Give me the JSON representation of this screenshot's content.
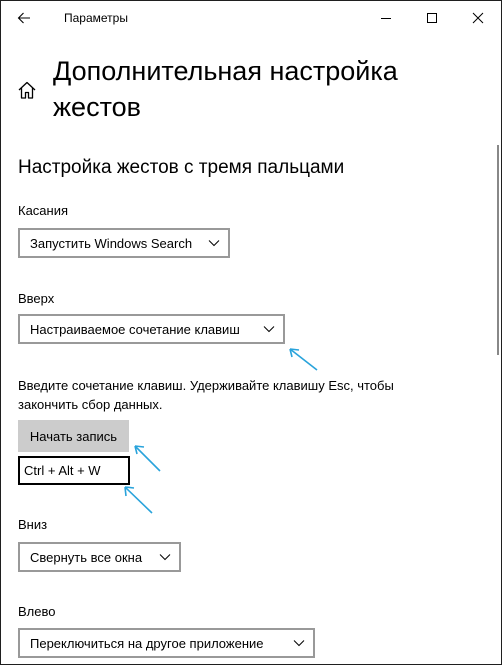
{
  "window": {
    "title": "Параметры",
    "icons": {
      "back": "back-arrow-icon",
      "minimize": "minimize-icon",
      "maximize": "maximize-icon",
      "close": "close-icon",
      "home": "home-icon"
    }
  },
  "page": {
    "title": "Дополнительная настройка жестов",
    "section_title": "Настройка жестов с тремя пальцами"
  },
  "taps": {
    "label": "Касания",
    "value": "Запустить Windows Search"
  },
  "up": {
    "label": "Вверх",
    "value": "Настраиваемое сочетание клавиш"
  },
  "shortcut": {
    "hint": "Введите сочетание клавиш. Удерживайте клавишу Esc, чтобы закончить сбор данных.",
    "record_label": "Начать запись",
    "value": "Ctrl + Alt + W"
  },
  "down": {
    "label": "Вниз",
    "value": "Свернуть все окна"
  },
  "left": {
    "label": "Влево",
    "value": "Переключиться на другое приложение"
  },
  "colors": {
    "annotation_arrow": "#29a3db",
    "record_button_bg": "#cccccc",
    "dropdown_border": "#999999"
  }
}
